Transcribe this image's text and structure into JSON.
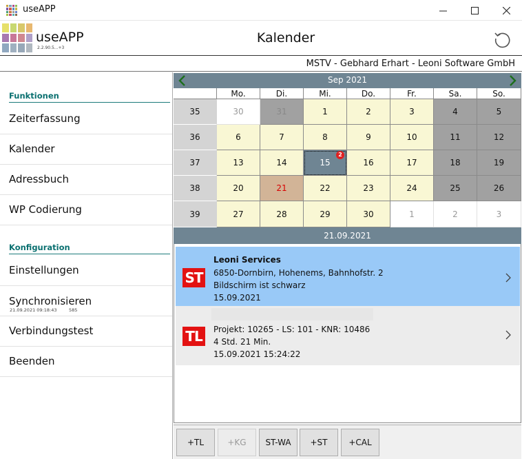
{
  "window": {
    "title": "useAPP",
    "controls": {
      "minimize": "minimize-icon",
      "maximize": "maximize-icon",
      "close": "close-icon"
    }
  },
  "header": {
    "app_name": "useAPP",
    "version": "2.2.90.5...+3",
    "page_title": "Kalender",
    "refresh_icon": "refresh-icon"
  },
  "user_bar": {
    "text": "MSTV - Gebhard Erhart - Leoni Software GmbH"
  },
  "sidebar": {
    "section_functions": "Funktionen",
    "items_functions": [
      {
        "label": "Zeiterfassung"
      },
      {
        "label": "Kalender"
      },
      {
        "label": "Adressbuch"
      },
      {
        "label": "WP Codierung"
      }
    ],
    "section_config": "Konfiguration",
    "items_config": [
      {
        "label": "Einstellungen"
      },
      {
        "label": "Synchronisieren",
        "sub_left": "21.09.2021 09:18:43",
        "sub_right": "585"
      },
      {
        "label": "Verbindungstest"
      },
      {
        "label": "Beenden"
      }
    ]
  },
  "calendar": {
    "month_label": "Sep 2021",
    "weekdays": [
      "Mo.",
      "Di.",
      "Mi.",
      "Do.",
      "Fr.",
      "Sa.",
      "So."
    ],
    "weeks": [
      {
        "week": "35",
        "days": [
          {
            "d": "30",
            "t": "other"
          },
          {
            "d": "31",
            "t": "other-gray"
          },
          {
            "d": "1",
            "t": "cur"
          },
          {
            "d": "2",
            "t": "cur"
          },
          {
            "d": "3",
            "t": "cur"
          },
          {
            "d": "4",
            "t": "we"
          },
          {
            "d": "5",
            "t": "we"
          }
        ]
      },
      {
        "week": "36",
        "days": [
          {
            "d": "6",
            "t": "cur"
          },
          {
            "d": "7",
            "t": "cur"
          },
          {
            "d": "8",
            "t": "cur"
          },
          {
            "d": "9",
            "t": "cur"
          },
          {
            "d": "10",
            "t": "cur"
          },
          {
            "d": "11",
            "t": "we"
          },
          {
            "d": "12",
            "t": "we"
          }
        ]
      },
      {
        "week": "37",
        "days": [
          {
            "d": "13",
            "t": "cur"
          },
          {
            "d": "14",
            "t": "cur"
          },
          {
            "d": "15",
            "t": "sel",
            "badge": "2"
          },
          {
            "d": "16",
            "t": "cur"
          },
          {
            "d": "17",
            "t": "cur"
          },
          {
            "d": "18",
            "t": "we"
          },
          {
            "d": "19",
            "t": "we"
          }
        ]
      },
      {
        "week": "38",
        "days": [
          {
            "d": "20",
            "t": "cur"
          },
          {
            "d": "21",
            "t": "today"
          },
          {
            "d": "22",
            "t": "cur"
          },
          {
            "d": "23",
            "t": "cur"
          },
          {
            "d": "24",
            "t": "cur"
          },
          {
            "d": "25",
            "t": "we"
          },
          {
            "d": "26",
            "t": "we"
          }
        ]
      },
      {
        "week": "39",
        "days": [
          {
            "d": "27",
            "t": "cur"
          },
          {
            "d": "28",
            "t": "cur"
          },
          {
            "d": "29",
            "t": "cur"
          },
          {
            "d": "30",
            "t": "cur"
          },
          {
            "d": "1",
            "t": "other"
          },
          {
            "d": "2",
            "t": "other"
          },
          {
            "d": "3",
            "t": "other"
          }
        ]
      }
    ],
    "selected_date_label": "21.09.2021"
  },
  "entries": [
    {
      "badge": "ST",
      "title": "Leoni Services",
      "line1": "6850-Dornbirn, Hohenems, Bahnhofstr. 2",
      "line2": "Bildschirm ist schwarz",
      "line3": "15.09.2021",
      "bg": "#99c9f7"
    },
    {
      "badge": "TL",
      "line1": "Projekt: 10265 - LS: 101 - KNR: 10486",
      "line2": "4 Std. 21 Min.",
      "line3": "15.09.2021 15:24:22",
      "bg": "#ececec"
    }
  ],
  "toolbar": {
    "buttons": [
      {
        "label": "+TL",
        "enabled": true
      },
      {
        "label": "+KG",
        "enabled": false
      },
      {
        "label": "ST-WA",
        "enabled": true
      },
      {
        "label": "+ST",
        "enabled": true
      },
      {
        "label": "+CAL",
        "enabled": true
      }
    ]
  },
  "colors": {
    "accent": "#6f8593",
    "heading": "#0a7070",
    "badge_red": "#e31212",
    "weekday_bg": "#f9f7d4",
    "weekend_bg": "#a1a1a1",
    "today_bg": "#d2b497",
    "selected_entry_bg": "#99c9f7"
  }
}
